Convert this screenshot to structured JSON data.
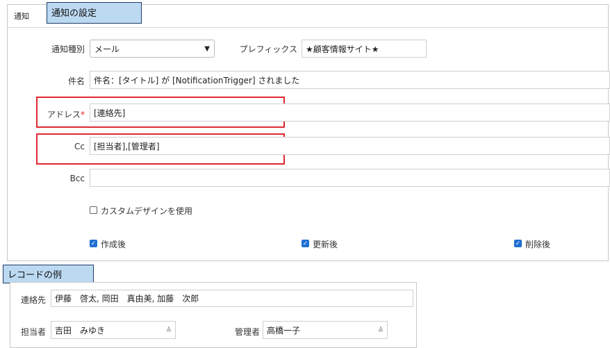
{
  "notify_tab": {
    "label": "通知"
  },
  "callout_top": "通知の設定",
  "form": {
    "type_label": "通知種別",
    "type_value": "メール",
    "prefix_label": "プレフィックス",
    "prefix_value": "★顧客情報サイト★",
    "subject_label": "件名",
    "subject_value": "件名：[タイトル] が [NotificationTrigger] されました",
    "address_label": "アドレス",
    "required_mark": "*",
    "address_value": "[連絡先]",
    "cc_label": "Cc",
    "cc_value": "[担当者],[管理者]",
    "bcc_label": "Bcc",
    "bcc_value": "",
    "custom_design_label": "カスタムデザインを使用",
    "custom_design_checked": false,
    "triggers": [
      {
        "label": "作成後",
        "checked": true
      },
      {
        "label": "更新後",
        "checked": true
      },
      {
        "label": "削除後",
        "checked": true
      }
    ]
  },
  "callout_bottom": "レコードの例",
  "record": {
    "contact_label": "連絡先",
    "contact_value": "伊藤　啓太, 岡田　真由美, 加藤　次郎",
    "owner_label": "担当者",
    "owner_value": "吉田　みゆき",
    "manager_label": "管理者",
    "manager_value": "高橋一子"
  },
  "icons": {
    "select_chevron": "chevron-down-icon",
    "user": "user-icon"
  },
  "colors": {
    "callout_bg": "#bcd9f2",
    "highlight": "#e0282e",
    "checkbox": "#1e6fd1",
    "required": "#d22222"
  }
}
